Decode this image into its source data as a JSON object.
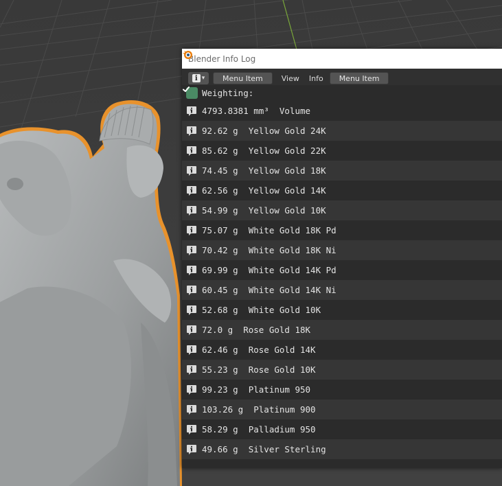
{
  "window": {
    "title": "Blender Info Log"
  },
  "toolbar": {
    "editor_type_icon": "info-icon",
    "menu_item_1": "Menu Item",
    "view": "View",
    "info": "Info",
    "menu_item_2": "Menu Item"
  },
  "log": {
    "header": "Weighting:",
    "entries": [
      {
        "text": "4793.8381 mm³  Volume",
        "icon": "info-icon"
      },
      {
        "text": "92.62 g  Yellow Gold 24K",
        "icon": "info-icon"
      },
      {
        "text": "85.62 g  Yellow Gold 22K",
        "icon": "info-icon"
      },
      {
        "text": "74.45 g  Yellow Gold 18K",
        "icon": "info-icon"
      },
      {
        "text": "62.56 g  Yellow Gold 14K",
        "icon": "info-icon"
      },
      {
        "text": "54.99 g  Yellow Gold 10K",
        "icon": "info-icon"
      },
      {
        "text": "75.07 g  White Gold 18K Pd",
        "icon": "info-icon"
      },
      {
        "text": "70.42 g  White Gold 18K Ni",
        "icon": "info-icon"
      },
      {
        "text": "69.99 g  White Gold 14K Pd",
        "icon": "info-icon"
      },
      {
        "text": "60.45 g  White Gold 14K Ni",
        "icon": "info-icon"
      },
      {
        "text": "52.68 g  White Gold 10K",
        "icon": "info-icon"
      },
      {
        "text": "72.0 g  Rose Gold 18K",
        "icon": "info-icon"
      },
      {
        "text": "62.46 g  Rose Gold 14K",
        "icon": "info-icon"
      },
      {
        "text": "55.23 g  Rose Gold 10K",
        "icon": "info-icon"
      },
      {
        "text": "99.23 g  Platinum 950",
        "icon": "info-icon"
      },
      {
        "text": "103.26 g  Platinum 900",
        "icon": "info-icon"
      },
      {
        "text": "58.29 g  Palladium 950",
        "icon": "info-icon"
      },
      {
        "text": "49.66 g  Silver Sterling",
        "icon": "info-icon"
      }
    ]
  },
  "colors": {
    "selection_outline": "#e8922c",
    "header_check": "#4a8a64",
    "info_icon_bg": "#dcdcdc",
    "row_even": "#2b2b2b",
    "row_odd": "#363636"
  }
}
